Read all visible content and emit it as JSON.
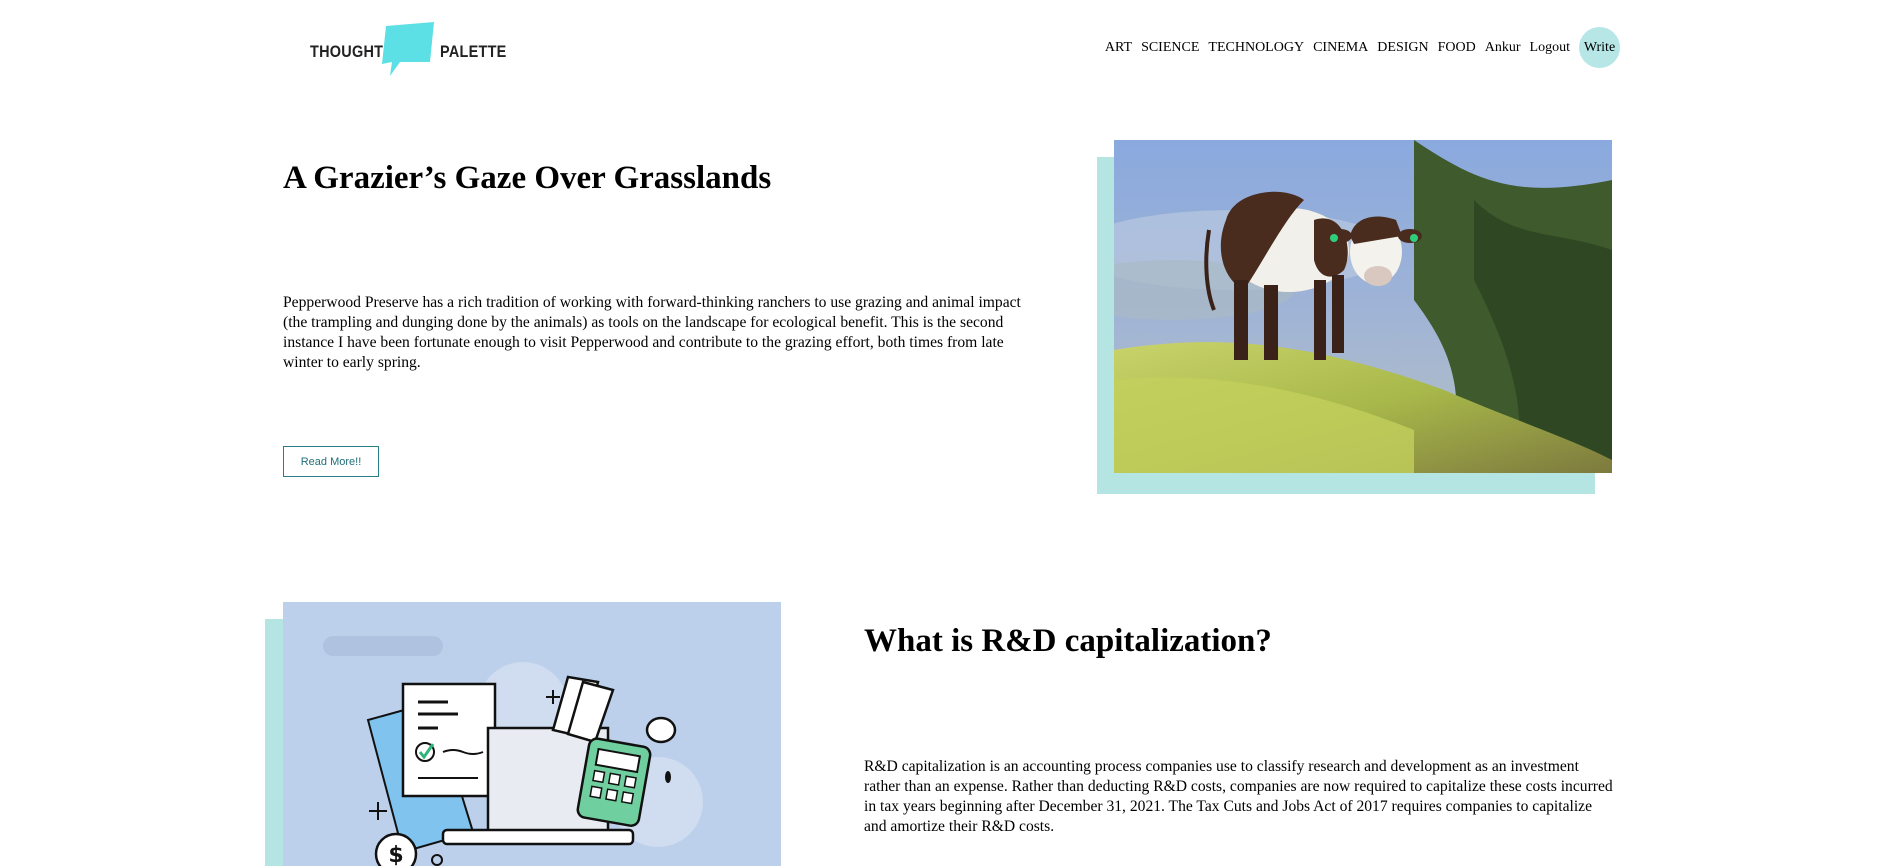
{
  "header": {
    "logo": {
      "word_left": "THOUGHT",
      "word_right": "PALETTE",
      "accent_color": "#5ddfe6"
    },
    "nav": {
      "items": [
        "ART",
        "SCIENCE",
        "TECHNOLOGY",
        "CINEMA",
        "DESIGN",
        "FOOD"
      ],
      "user": "Ankur",
      "logout": "Logout",
      "write": "Write"
    }
  },
  "articles": [
    {
      "title": "A Grazier’s Gaze Over Grasslands",
      "excerpt": "Pepperwood Preserve has a rich tradition of working with forward-thinking ranchers to use grazing and animal impact (the trampling and dunging done by the animals) as tools on the landscape for ecological benefit. This is the second instance I have been fortunate enough to visit Pepperwood and contribute to the grazing effort, both times from late winter to early spring.",
      "read_more": "Read More!!",
      "image": "cow-on-hillside-photo"
    },
    {
      "title": "What is R&D capitalization?",
      "excerpt": "R&D capitalization is an accounting process companies use to classify research and development as an investment rather than an expense. Rather than deducting R&D costs, companies are now required to capitalize these costs incurred in tax years beginning after December 31, 2021. The Tax Cuts and Jobs Act of 2017 requires companies to capitalize and amortize their R&D costs.",
      "image": "accounting-illustration"
    }
  ],
  "colors": {
    "image_shadow": "#b5e5e3",
    "write_button": "#b6e6e6",
    "button_border": "#2a7f86",
    "illustration_bg": "#bcd0ec"
  }
}
